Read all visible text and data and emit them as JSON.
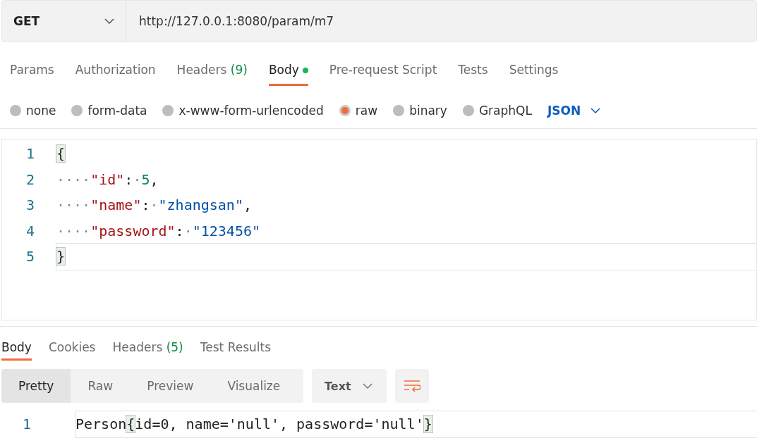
{
  "request": {
    "method": "GET",
    "url": "http://127.0.0.1:8080/param/m7"
  },
  "request_tabs": [
    {
      "label": "Params",
      "selected": false
    },
    {
      "label": "Authorization",
      "selected": false
    },
    {
      "label": "Headers",
      "count": "(9)",
      "selected": false
    },
    {
      "label": "Body",
      "selected": true,
      "has_content": true
    },
    {
      "label": "Pre-request Script",
      "selected": false
    },
    {
      "label": "Tests",
      "selected": false
    },
    {
      "label": "Settings",
      "selected": false
    }
  ],
  "body_types": [
    {
      "label": "none",
      "selected": false
    },
    {
      "label": "form-data",
      "selected": false
    },
    {
      "label": "x-www-form-urlencoded",
      "selected": false
    },
    {
      "label": "raw",
      "selected": true
    },
    {
      "label": "binary",
      "selected": false
    },
    {
      "label": "GraphQL",
      "selected": false
    }
  ],
  "language": "JSON",
  "editor_lines": [
    {
      "number": "1",
      "active": false,
      "tokens": [
        {
          "kind": "bracket_match",
          "text": "{"
        }
      ]
    },
    {
      "number": "2",
      "active": false,
      "tokens": [
        {
          "kind": "whitespace",
          "text": "····"
        },
        {
          "kind": "key",
          "text": "\"id\""
        },
        {
          "kind": "punct",
          "text": ":"
        },
        {
          "kind": "whitespace",
          "text": "·"
        },
        {
          "kind": "number",
          "text": "5"
        },
        {
          "kind": "punct",
          "text": ","
        }
      ]
    },
    {
      "number": "3",
      "active": false,
      "tokens": [
        {
          "kind": "whitespace",
          "text": "····"
        },
        {
          "kind": "key",
          "text": "\"name\""
        },
        {
          "kind": "punct",
          "text": ":"
        },
        {
          "kind": "whitespace",
          "text": "·"
        },
        {
          "kind": "string",
          "text": "\"zhangsan\""
        },
        {
          "kind": "punct",
          "text": ","
        }
      ]
    },
    {
      "number": "4",
      "active": false,
      "tokens": [
        {
          "kind": "whitespace",
          "text": "····"
        },
        {
          "kind": "key",
          "text": "\"password\""
        },
        {
          "kind": "punct",
          "text": ":"
        },
        {
          "kind": "whitespace",
          "text": "·"
        },
        {
          "kind": "string",
          "text": "\"123456\""
        }
      ]
    },
    {
      "number": "5",
      "active": true,
      "tokens": [
        {
          "kind": "bracket_match",
          "text": "}"
        }
      ]
    }
  ],
  "response_tabs": [
    {
      "label": "Body",
      "selected": true
    },
    {
      "label": "Cookies",
      "selected": false
    },
    {
      "label": "Headers",
      "count": "(5)",
      "selected": false
    },
    {
      "label": "Test Results",
      "selected": false
    }
  ],
  "view_modes": [
    {
      "label": "Pretty",
      "selected": true
    },
    {
      "label": "Raw",
      "selected": false
    },
    {
      "label": "Preview",
      "selected": false
    },
    {
      "label": "Visualize",
      "selected": false
    }
  ],
  "format": "Text",
  "response_lines": [
    {
      "number": "1",
      "active": true,
      "tokens": [
        {
          "kind": "plain",
          "text": "Person"
        },
        {
          "kind": "bracket_match",
          "text": "{"
        },
        {
          "kind": "plain",
          "text": "id=0, name='null', password='null'"
        },
        {
          "kind": "bracket_match",
          "text": "}"
        }
      ]
    }
  ]
}
